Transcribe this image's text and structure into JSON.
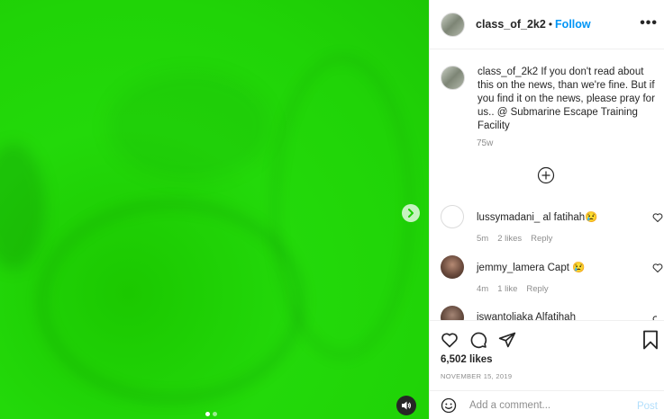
{
  "post": {
    "owner": "class_of_2k2",
    "separator": "•",
    "follow_label": "Follow",
    "more_label": "•••",
    "caption": "If you don't read about this on the news, than we're fine. But if you find it on the news, please pray for us.. @ Submarine Escape Training Facility",
    "caption_time": "75w",
    "likes": "6,502 likes",
    "date": "NOVEMBER 15, 2019"
  },
  "media": {
    "background_color": "#23d90a",
    "slide_count": 2,
    "active_slide": 1
  },
  "comments": [
    {
      "user": "lussymadani_",
      "text": "al fatihah",
      "emoji": "😢",
      "time": "5m",
      "likes": "2 likes",
      "reply_label": "Reply"
    },
    {
      "user": "jemmy_lamera",
      "text": "Capt",
      "emoji": "😢",
      "time": "4m",
      "likes": "1 like",
      "reply_label": "Reply"
    },
    {
      "user": "iswantoliaka",
      "text": "Alfatihah",
      "emoji": "",
      "time": "",
      "likes": "",
      "reply_label": ""
    }
  ],
  "comment_box": {
    "placeholder": "Add a comment...",
    "post_label": "Post"
  },
  "colors": {
    "accent": "#0095f6",
    "post_disabled": "#b2dffc",
    "muted": "#8e8e8e"
  },
  "icons": {
    "like": "heart-icon",
    "comment": "comment-icon",
    "share": "share-icon",
    "save": "bookmark-icon",
    "emoji": "smile-icon",
    "sound": "speaker-icon",
    "next": "chevron-right-icon",
    "load_more": "plus-circle-icon"
  }
}
